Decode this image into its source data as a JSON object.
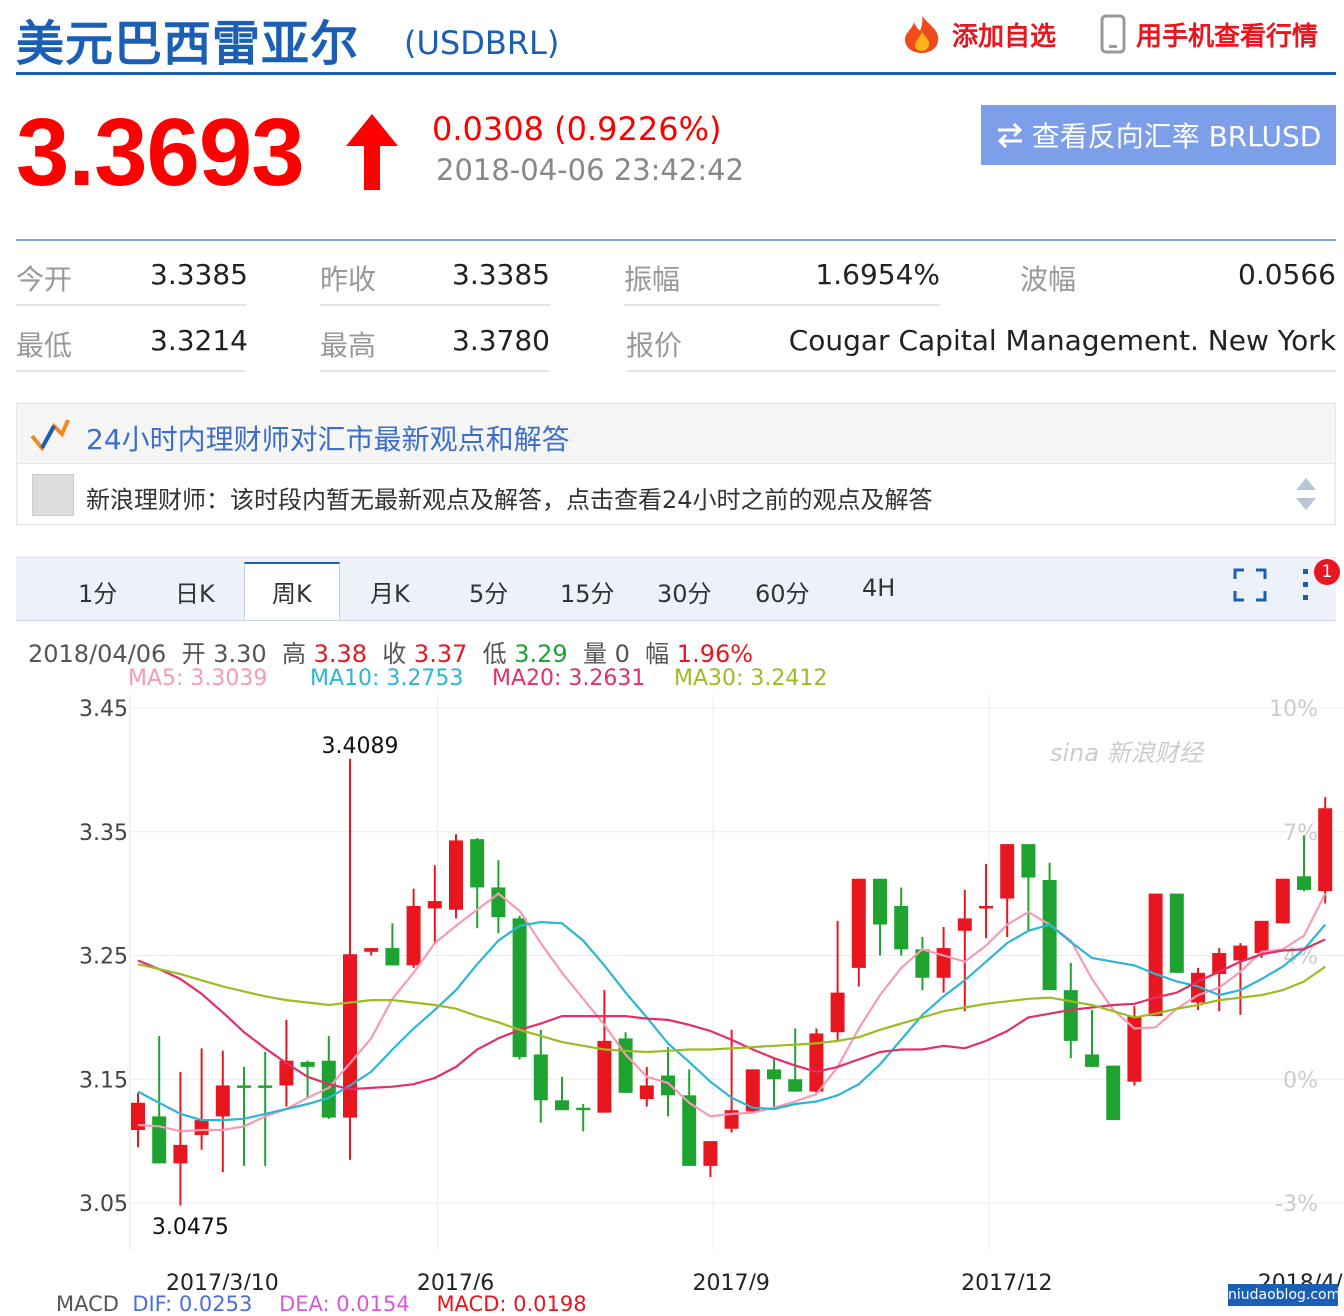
{
  "header": {
    "title": "美元巴西雷亚尔",
    "code": "(USDBRL)",
    "add_watch": "添加自选",
    "mobile": "用手机查看行情"
  },
  "quote": {
    "price": "3.3693",
    "change": "0.0308 (0.9226%)",
    "time": "2018-04-06 23:42:42",
    "reverse_button": "查看反向汇率 BRLUSD"
  },
  "stats": [
    {
      "label": "今开",
      "value": "3.3385"
    },
    {
      "label": "昨收",
      "value": "3.3385"
    },
    {
      "label": "振幅",
      "value": "1.6954%"
    },
    {
      "label": "波幅",
      "value": "0.0566"
    },
    {
      "label": "最低",
      "value": "3.3214"
    },
    {
      "label": "最高",
      "value": "3.3780"
    },
    {
      "label": "报价",
      "value": "Cougar Capital Management. New York"
    }
  ],
  "advisor": {
    "title": "24小时内理财师对汇市最新观点和解答",
    "message": "新浪理财师：该时段内暂无最新观点及解答，点击查看24小时之前的观点及解答"
  },
  "tabs": [
    "1分",
    "日K",
    "周K",
    "月K",
    "5分",
    "15分",
    "30分",
    "60分",
    "4H"
  ],
  "active_tab": "周K",
  "notification_badge": "1",
  "bar_info": {
    "date": "2018/04/06",
    "open_label": "开",
    "open": "3.30",
    "high_label": "高",
    "high": "3.38",
    "close_label": "收",
    "close": "3.37",
    "low_label": "低",
    "low": "3.29",
    "vol_label": "量",
    "vol": "0",
    "amp_label": "幅",
    "amp": "1.96%"
  },
  "ma_labels": {
    "ma5": "MA5: 3.3039",
    "ma10": "MA10: 3.2753",
    "ma20": "MA20: 3.2631",
    "ma30": "MA30: 3.2412"
  },
  "watermark": "sina 新浪财经",
  "macd": {
    "label": "MACD",
    "dif": "DIF: 0.0253",
    "dea": "DEA: 0.0154",
    "macd": "MACD: 0.0198"
  },
  "corner_watermark": "niudaoblog.com",
  "colors": {
    "up": "#e8161e",
    "down": "#1ea330",
    "ma5": "#f59bb6",
    "ma10": "#2ab7d4",
    "ma20": "#e0306a",
    "ma30": "#9cbc22",
    "brand": "#1a5fb4"
  },
  "chart_data": {
    "type": "candlestick",
    "ylim": [
      3.05,
      3.45
    ],
    "yticks": [
      "3.45",
      "3.35",
      "3.25",
      "3.15",
      "3.05"
    ],
    "right_ticks": [
      "10%",
      "7%",
      "4%",
      "0%",
      "-3%"
    ],
    "xlabels": [
      "2017/3/10",
      "2017/6",
      "2017/9",
      "2017/12",
      "2018/4/6"
    ],
    "xlabel_index": [
      2,
      13,
      26,
      39,
      56
    ],
    "annotations": [
      {
        "text": "3.4089",
        "index": 10,
        "value": 3.4089
      },
      {
        "text": "3.0475",
        "index": 2,
        "value": 3.0475
      }
    ],
    "candles": [
      {
        "o": 3.109,
        "h": 3.139,
        "l": 3.095,
        "c": 3.131
      },
      {
        "o": 3.12,
        "h": 3.185,
        "l": 3.09,
        "c": 3.082
      },
      {
        "o": 3.082,
        "h": 3.156,
        "l": 3.048,
        "c": 3.097
      },
      {
        "o": 3.105,
        "h": 3.175,
        "l": 3.093,
        "c": 3.117
      },
      {
        "o": 3.12,
        "h": 3.173,
        "l": 3.075,
        "c": 3.145
      },
      {
        "o": 3.145,
        "h": 3.16,
        "l": 3.08,
        "c": 3.143
      },
      {
        "o": 3.145,
        "h": 3.172,
        "l": 3.08,
        "c": 3.143
      },
      {
        "o": 3.145,
        "h": 3.198,
        "l": 3.128,
        "c": 3.165
      },
      {
        "o": 3.164,
        "h": 3.165,
        "l": 3.135,
        "c": 3.16
      },
      {
        "o": 3.165,
        "h": 3.185,
        "l": 3.118,
        "c": 3.119
      },
      {
        "o": 3.119,
        "h": 3.409,
        "l": 3.085,
        "c": 3.251
      },
      {
        "o": 3.253,
        "h": 3.255,
        "l": 3.25,
        "c": 3.256
      },
      {
        "o": 3.256,
        "h": 3.276,
        "l": 3.243,
        "c": 3.242
      },
      {
        "o": 3.242,
        "h": 3.304,
        "l": 3.24,
        "c": 3.29
      },
      {
        "o": 3.288,
        "h": 3.323,
        "l": 3.26,
        "c": 3.294
      },
      {
        "o": 3.287,
        "h": 3.348,
        "l": 3.28,
        "c": 3.343
      },
      {
        "o": 3.344,
        "h": 3.345,
        "l": 3.272,
        "c": 3.305
      },
      {
        "o": 3.305,
        "h": 3.327,
        "l": 3.268,
        "c": 3.281
      },
      {
        "o": 3.28,
        "h": 3.282,
        "l": 3.166,
        "c": 3.168
      },
      {
        "o": 3.17,
        "h": 3.19,
        "l": 3.115,
        "c": 3.133
      },
      {
        "o": 3.133,
        "h": 3.152,
        "l": 3.134,
        "c": 3.125
      },
      {
        "o": 3.127,
        "h": 3.13,
        "l": 3.108,
        "c": 3.125
      },
      {
        "o": 3.123,
        "h": 3.222,
        "l": 3.15,
        "c": 3.181
      },
      {
        "o": 3.183,
        "h": 3.188,
        "l": 3.14,
        "c": 3.139
      },
      {
        "o": 3.134,
        "h": 3.16,
        "l": 3.128,
        "c": 3.145
      },
      {
        "o": 3.153,
        "h": 3.176,
        "l": 3.12,
        "c": 3.137
      },
      {
        "o": 3.137,
        "h": 3.158,
        "l": 3.117,
        "c": 3.08
      },
      {
        "o": 3.08,
        "h": 3.09,
        "l": 3.071,
        "c": 3.1
      },
      {
        "o": 3.11,
        "h": 3.19,
        "l": 3.107,
        "c": 3.125
      },
      {
        "o": 3.124,
        "h": 3.158,
        "l": 3.14,
        "c": 3.158
      },
      {
        "o": 3.158,
        "h": 3.168,
        "l": 3.127,
        "c": 3.15
      },
      {
        "o": 3.15,
        "h": 3.191,
        "l": 3.141,
        "c": 3.14
      },
      {
        "o": 3.14,
        "h": 3.191,
        "l": 3.139,
        "c": 3.187
      },
      {
        "o": 3.188,
        "h": 3.278,
        "l": 3.18,
        "c": 3.22
      },
      {
        "o": 3.24,
        "h": 3.297,
        "l": 3.225,
        "c": 3.312
      },
      {
        "o": 3.312,
        "h": 3.297,
        "l": 3.25,
        "c": 3.275
      },
      {
        "o": 3.29,
        "h": 3.305,
        "l": 3.25,
        "c": 3.255
      },
      {
        "o": 3.255,
        "h": 3.265,
        "l": 3.222,
        "c": 3.232
      },
      {
        "o": 3.232,
        "h": 3.273,
        "l": 3.22,
        "c": 3.256
      },
      {
        "o": 3.27,
        "h": 3.303,
        "l": 3.205,
        "c": 3.28
      },
      {
        "o": 3.288,
        "h": 3.324,
        "l": 3.264,
        "c": 3.29
      },
      {
        "o": 3.296,
        "h": 3.331,
        "l": 3.265,
        "c": 3.34
      },
      {
        "o": 3.34,
        "h": 3.34,
        "l": 3.27,
        "c": 3.313
      },
      {
        "o": 3.311,
        "h": 3.325,
        "l": 3.233,
        "c": 3.222
      },
      {
        "o": 3.222,
        "h": 3.244,
        "l": 3.167,
        "c": 3.181
      },
      {
        "o": 3.17,
        "h": 3.206,
        "l": 3.165,
        "c": 3.16
      },
      {
        "o": 3.161,
        "h": 3.159,
        "l": 3.121,
        "c": 3.117
      },
      {
        "o": 3.148,
        "h": 3.209,
        "l": 3.145,
        "c": 3.201
      },
      {
        "o": 3.201,
        "h": 3.263,
        "l": 3.213,
        "c": 3.3
      },
      {
        "o": 3.3,
        "h": 3.298,
        "l": 3.265,
        "c": 3.236
      },
      {
        "o": 3.212,
        "h": 3.24,
        "l": 3.206,
        "c": 3.236
      },
      {
        "o": 3.235,
        "h": 3.256,
        "l": 3.205,
        "c": 3.252
      },
      {
        "o": 3.246,
        "h": 3.26,
        "l": 3.202,
        "c": 3.258
      },
      {
        "o": 3.252,
        "h": 3.27,
        "l": 3.248,
        "c": 3.278
      },
      {
        "o": 3.276,
        "h": 3.297,
        "l": 3.282,
        "c": 3.312
      },
      {
        "o": 3.314,
        "h": 3.347,
        "l": 3.302,
        "c": 3.303
      },
      {
        "o": 3.302,
        "h": 3.378,
        "l": 3.292,
        "c": 3.369
      }
    ],
    "series": [
      {
        "name": "MA5",
        "values": [
          3.113,
          3.112,
          3.108,
          3.109,
          3.109,
          3.112,
          3.12,
          3.126,
          3.135,
          3.143,
          3.163,
          3.183,
          3.215,
          3.236,
          3.26,
          3.274,
          3.287,
          3.3,
          3.286,
          3.26,
          3.236,
          3.215,
          3.194,
          3.17,
          3.152,
          3.147,
          3.131,
          3.12,
          3.122,
          3.123,
          3.127,
          3.132,
          3.138,
          3.16,
          3.191,
          3.218,
          3.24,
          3.255,
          3.25,
          3.245,
          3.258,
          3.275,
          3.285,
          3.275,
          3.262,
          3.231,
          3.206,
          3.191,
          3.192,
          3.207,
          3.218,
          3.224,
          3.237,
          3.253,
          3.255,
          3.266,
          3.3
        ]
      },
      {
        "name": "MA10",
        "values": [
          3.14,
          3.131,
          3.122,
          3.117,
          3.117,
          3.118,
          3.122,
          3.126,
          3.13,
          3.135,
          3.145,
          3.156,
          3.174,
          3.191,
          3.206,
          3.222,
          3.243,
          3.262,
          3.274,
          3.277,
          3.276,
          3.262,
          3.242,
          3.22,
          3.2,
          3.179,
          3.164,
          3.148,
          3.135,
          3.127,
          3.126,
          3.13,
          3.132,
          3.137,
          3.146,
          3.162,
          3.182,
          3.202,
          3.217,
          3.23,
          3.245,
          3.26,
          3.27,
          3.275,
          3.261,
          3.248,
          3.245,
          3.242,
          3.235,
          3.229,
          3.225,
          3.218,
          3.222,
          3.231,
          3.241,
          3.255,
          3.275
        ]
      },
      {
        "name": "MA20",
        "values": [
          3.246,
          3.239,
          3.231,
          3.219,
          3.204,
          3.188,
          3.175,
          3.163,
          3.152,
          3.146,
          3.142,
          3.143,
          3.144,
          3.146,
          3.151,
          3.16,
          3.174,
          3.183,
          3.19,
          3.195,
          3.201,
          3.201,
          3.201,
          3.201,
          3.199,
          3.198,
          3.194,
          3.189,
          3.182,
          3.174,
          3.167,
          3.161,
          3.156,
          3.16,
          3.166,
          3.172,
          3.174,
          3.174,
          3.177,
          3.175,
          3.181,
          3.189,
          3.2,
          3.203,
          3.206,
          3.208,
          3.21,
          3.211,
          3.216,
          3.22,
          3.229,
          3.237,
          3.245,
          3.251,
          3.254,
          3.255,
          3.263
        ]
      },
      {
        "name": "MA30",
        "values": [
          3.243,
          3.239,
          3.235,
          3.23,
          3.225,
          3.221,
          3.217,
          3.214,
          3.212,
          3.21,
          3.212,
          3.214,
          3.214,
          3.212,
          3.21,
          3.207,
          3.201,
          3.196,
          3.19,
          3.185,
          3.18,
          3.177,
          3.174,
          3.173,
          3.172,
          3.173,
          3.174,
          3.174,
          3.175,
          3.176,
          3.177,
          3.178,
          3.179,
          3.181,
          3.184,
          3.19,
          3.195,
          3.2,
          3.205,
          3.208,
          3.211,
          3.213,
          3.215,
          3.216,
          3.213,
          3.21,
          3.205,
          3.2,
          3.203,
          3.207,
          3.21,
          3.214,
          3.216,
          3.218,
          3.222,
          3.229,
          3.241
        ]
      }
    ]
  }
}
